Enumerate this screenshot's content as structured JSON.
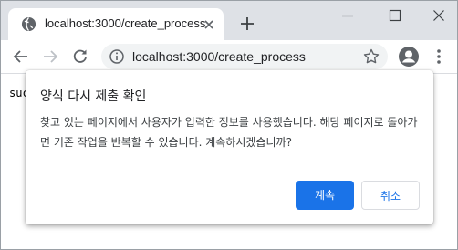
{
  "browser": {
    "tab": {
      "title": "localhost:3000/create_process"
    },
    "address": {
      "url": "localhost:3000/create_process"
    },
    "icons": [
      "globe-icon",
      "close-icon",
      "plus-icon",
      "minimize-icon",
      "maximize-icon",
      "window-close-icon",
      "back-icon",
      "forward-icon",
      "reload-icon",
      "info-icon",
      "star-icon",
      "profile-icon",
      "menu-icon"
    ]
  },
  "page": {
    "text": "suc"
  },
  "dialog": {
    "title": "양식 다시 제출 확인",
    "message": "찾고 있는 페이지에서 사용자가 입력한 정보를 사용했습니다. 해당 페이지로 돌아가면 기존 작업을 반복할 수 있습니다. 계속하시겠습니까?",
    "confirm_label": "계속",
    "cancel_label": "취소"
  },
  "colors": {
    "accent": "#1a73e8",
    "tabstrip": "#dee1e6"
  }
}
